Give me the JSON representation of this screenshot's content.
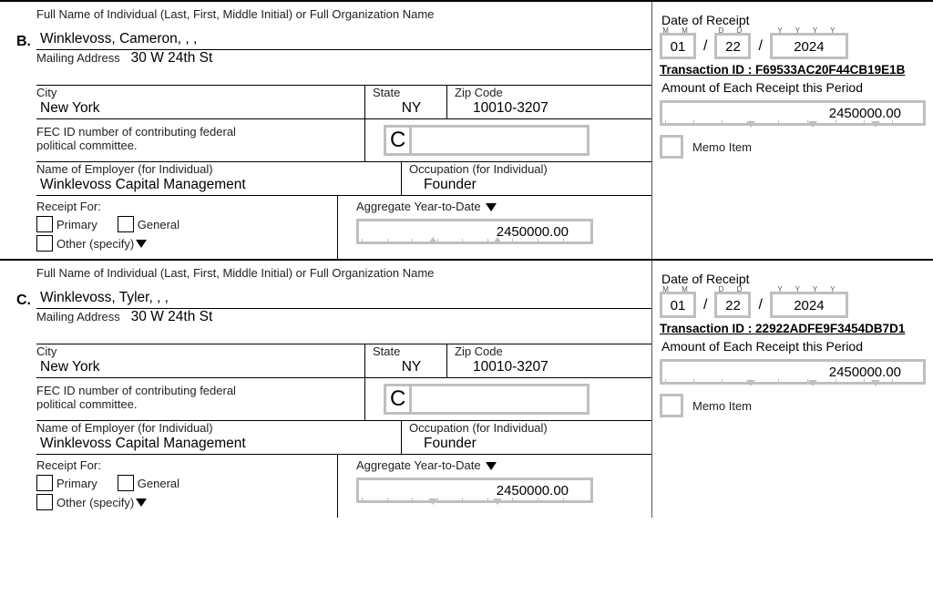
{
  "labels": {
    "fullName": "Full Name of Individual (Last, First, Middle Initial) or Full Organization Name",
    "mailingAddress": "Mailing Address",
    "city": "City",
    "state": "State",
    "zip": "Zip Code",
    "fecId": "FEC ID number of contributing federal political committee.",
    "employer": "Name of Employer (for Individual)",
    "occupation": "Occupation (for Individual)",
    "receiptFor": "Receipt For:",
    "primary": "Primary",
    "general": "General",
    "otherSpecify": "Other (specify)",
    "aggregateYtd": "Aggregate Year-to-Date",
    "dateOfReceipt": "Date of Receipt",
    "transactionIdPrefix": "Transaction ID :",
    "amountEach": "Amount of Each Receipt this Period",
    "memoItem": "Memo Item",
    "dateM": "M   M",
    "dateD": "D    D",
    "dateY": "Y   Y   Y   Y",
    "cPrefix": "C"
  },
  "entries": [
    {
      "letter": "B.",
      "name": "Winklevoss, Cameron, , ,",
      "address": "30 W 24th St",
      "city": "New York",
      "state": "NY",
      "zip": "10010-3207",
      "fecId": "",
      "employer": "Winklevoss Capital Management",
      "occupation": "Founder",
      "aggregateYtd": "2450000.00",
      "date": {
        "mm": "01",
        "dd": "22",
        "yyyy": "2024"
      },
      "transactionId": "F69533AC20F44CB19E1B",
      "amount": "2450000.00"
    },
    {
      "letter": "C.",
      "name": "Winklevoss, Tyler, , ,",
      "address": "30 W 24th St",
      "city": "New York",
      "state": "NY",
      "zip": "10010-3207",
      "fecId": "",
      "employer": "Winklevoss Capital Management",
      "occupation": "Founder",
      "aggregateYtd": "2450000.00",
      "date": {
        "mm": "01",
        "dd": "22",
        "yyyy": "2024"
      },
      "transactionId": "22922ADFE9F3454DB7D1",
      "amount": "2450000.00"
    }
  ]
}
